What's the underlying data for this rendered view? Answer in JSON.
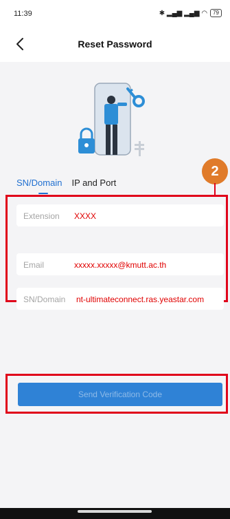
{
  "status_bar": {
    "time": "11:39",
    "signal": "✱ .∥l .∥l",
    "battery": "79"
  },
  "header": {
    "title": "Reset Password"
  },
  "annotation": {
    "step_number": "2"
  },
  "tabs": [
    {
      "label": "SN/Domain",
      "active": true
    },
    {
      "label": "IP and Port",
      "active": false
    }
  ],
  "form": {
    "extension": {
      "label": "Extension",
      "value": "XXXX"
    },
    "email": {
      "label": "Email",
      "value": "xxxxx.xxxxx@kmutt.ac.th"
    },
    "domain": {
      "label": "SN/Domain",
      "value": "nt-ultimateconnect.ras.yeastar.com"
    }
  },
  "actions": {
    "send_label": "Send Verification Code"
  },
  "colors": {
    "accent": "#1f6fd0",
    "button": "#2f82d6",
    "highlight": "#e0001a",
    "badge": "#e07b2a"
  }
}
